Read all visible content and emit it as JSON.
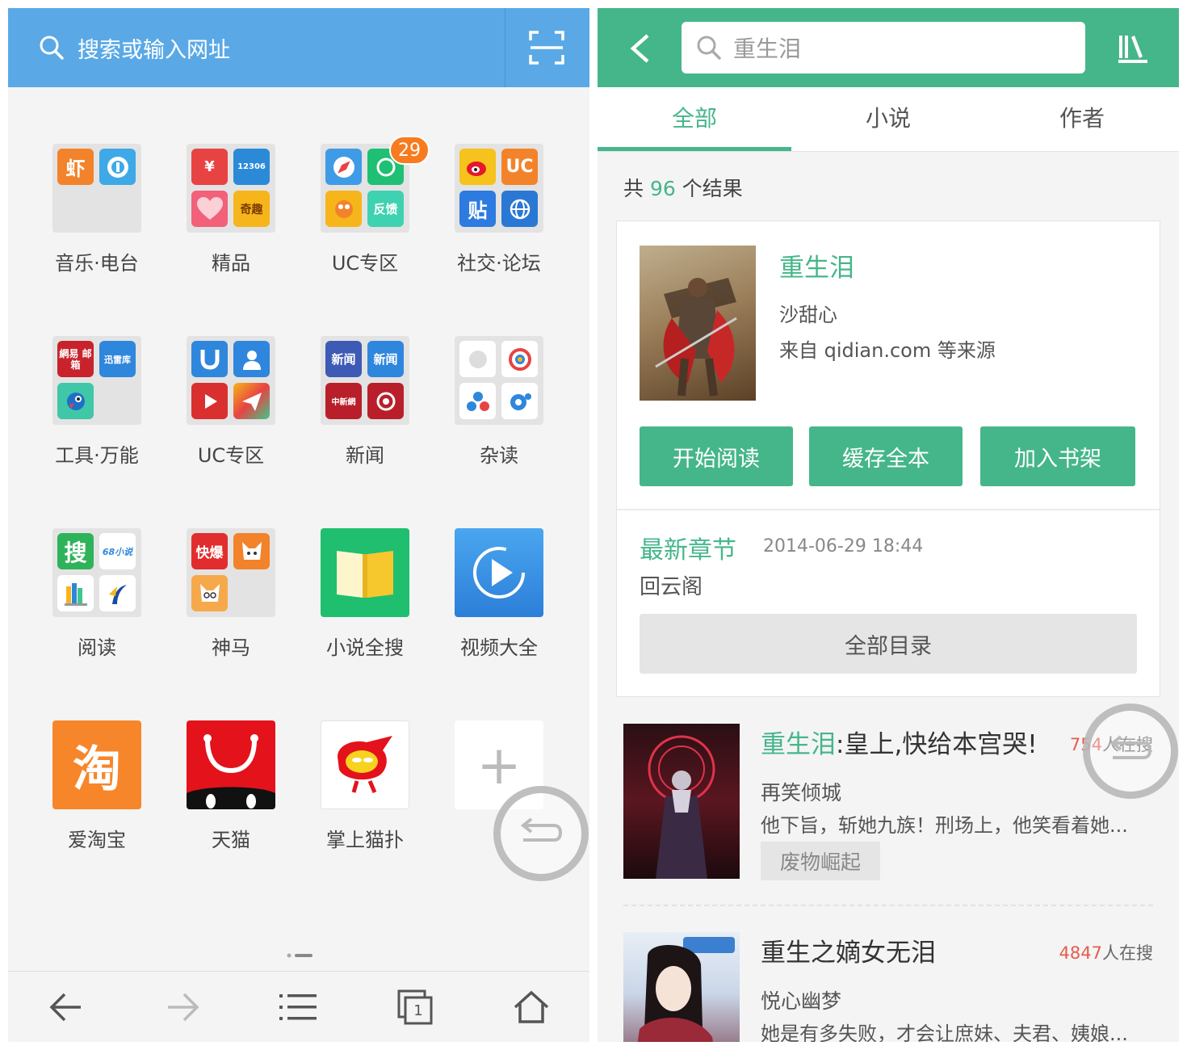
{
  "left": {
    "search_placeholder": "搜索或输入网址",
    "apps": [
      {
        "label": "音乐·电台"
      },
      {
        "label": "精品"
      },
      {
        "label": "UC专区",
        "badge": "29"
      },
      {
        "label": "社交·论坛"
      },
      {
        "label": "工具·万能"
      },
      {
        "label": "UC专区"
      },
      {
        "label": "新闻"
      },
      {
        "label": "杂读"
      },
      {
        "label": "阅读"
      },
      {
        "label": "神马"
      },
      {
        "label": "小说全搜"
      },
      {
        "label": "视频大全"
      },
      {
        "label": "爱淘宝"
      },
      {
        "label": "天猫"
      },
      {
        "label": "掌上猫扑"
      }
    ],
    "mini_icons": {
      "xia": "虾",
      "rmb": "¥",
      "train": "12306",
      "qiqu": "奇趣",
      "fankui": "反馈",
      "uc": "UC",
      "tie": "贴",
      "mail": "網易 邮箱",
      "xunlei": "迅雷库",
      "xinwen1": "新闻",
      "xinwen2": "新闻",
      "zhongxin": "中新網",
      "sou": "搜",
      "xs68": "68小说",
      "kuaibao": "快爆",
      "tao": "淘",
      "add": "+"
    },
    "nav": {
      "tabs_count": "1"
    }
  },
  "right": {
    "search_value": "重生泪",
    "tabs": [
      "全部",
      "小说",
      "作者"
    ],
    "count_prefix": "共",
    "count_num": "96",
    "count_suffix": "个结果",
    "top_result": {
      "title": "重生泪",
      "author": "沙甜心",
      "source": "来自 qidian.com 等来源",
      "buttons": [
        "开始阅读",
        "缓存全本",
        "加入书架"
      ],
      "latest_label": "最新章节",
      "latest_date": "2014-06-29 18:44",
      "latest_chapter": "回云阁",
      "catalog": "全部目录"
    },
    "items": [
      {
        "title_hl": "重生泪",
        "title_rest": ":皇上,快给本宫哭!",
        "search_num": "754",
        "search_suffix": "人在搜",
        "author": "再笑倾城",
        "desc": "他下旨，斩她九族！刑场上，他笑看着她...",
        "tag": "废物崛起"
      },
      {
        "title": "重生之嫡女无泪",
        "search_num": "4847",
        "search_suffix": "人在搜",
        "author": "悦心幽梦",
        "desc": "她是有多失败，才会让庶妹、夫君、姨娘..."
      }
    ]
  }
}
